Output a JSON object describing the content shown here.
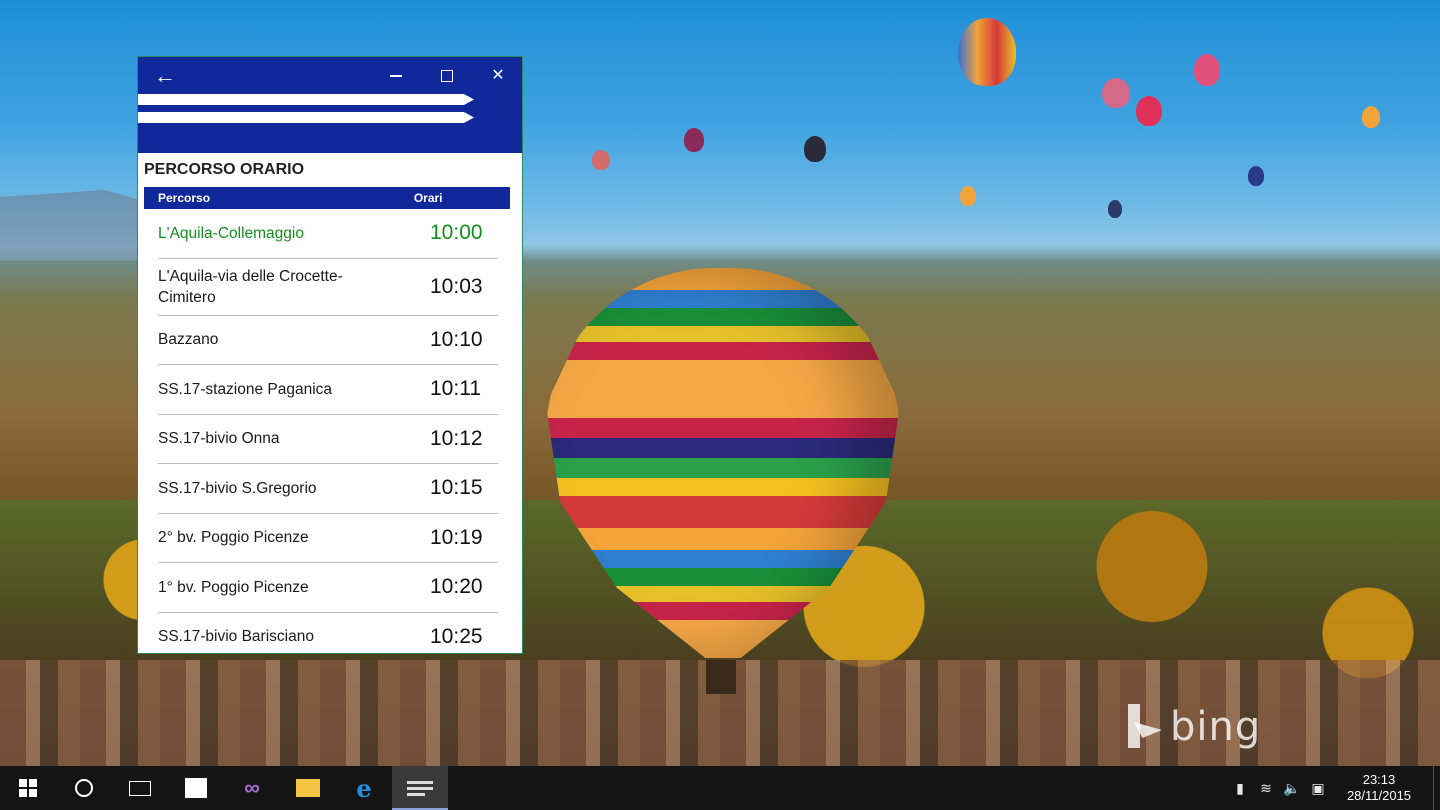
{
  "app": {
    "section_title": "PERCORSO ORARIO",
    "table": {
      "headers": {
        "route": "Percorso",
        "time": "Orari"
      },
      "rows": [
        {
          "route": "L'Aquila-Collemaggio",
          "time": "10:00",
          "highlight": true
        },
        {
          "route": "L'Aquila-via delle Crocette-Cimitero",
          "time": "10:03"
        },
        {
          "route": "Bazzano",
          "time": "10:10"
        },
        {
          "route": "SS.17-stazione Paganica",
          "time": "10:11"
        },
        {
          "route": "SS.17-bivio Onna",
          "time": "10:12"
        },
        {
          "route": "SS.17-bivio S.Gregorio",
          "time": "10:15"
        },
        {
          "route": "2° bv. Poggio Picenze",
          "time": "10:19"
        },
        {
          "route": "1° bv. Poggio Picenze",
          "time": "10:20"
        },
        {
          "route": "SS.17-bivio Barisciano",
          "time": "10:25"
        }
      ]
    },
    "titlebar_icons": [
      "back-arrow-icon",
      "minimize-icon",
      "maximize-icon",
      "close-icon"
    ],
    "colors": {
      "titlebar": "#11289a",
      "highlight": "#138f1e"
    }
  },
  "wallpaper": {
    "watermark": "bing"
  },
  "taskbar": {
    "pinned": [
      "windows-start-icon",
      "cortana-icon",
      "task-view-icon",
      "store-icon",
      "visual-studio-icon",
      "file-explorer-icon",
      "edge-icon",
      "bus-app-icon"
    ],
    "active": "bus-app-icon",
    "tray": [
      "power-icon",
      "wifi-icon",
      "volume-icon",
      "action-center-icon"
    ],
    "clock": {
      "time": "23:13",
      "date": "28/11/2015"
    }
  }
}
